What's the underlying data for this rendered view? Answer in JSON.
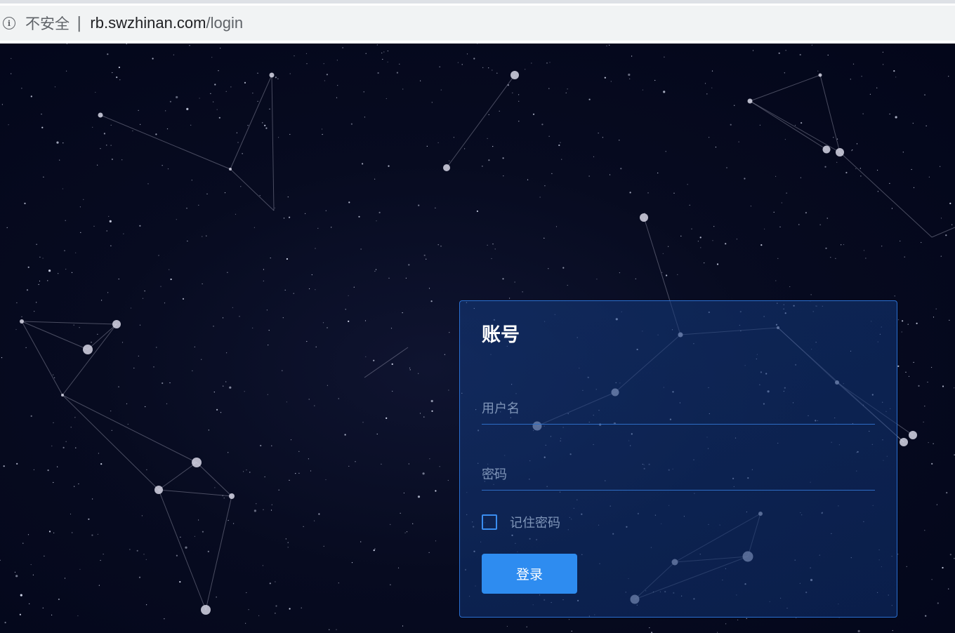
{
  "browser": {
    "security_label": "不安全",
    "separator": "|",
    "url_host": "rb.swzhinan.com",
    "url_path": "/login"
  },
  "login": {
    "title": "账号",
    "username_placeholder": "用户名",
    "password_placeholder": "密码",
    "remember_label": "记住密码",
    "remember_checked": false,
    "submit_label": "登录"
  },
  "colors": {
    "background": "#050a1c",
    "card_border": "#2a6fd0",
    "accent": "#2e8cf0"
  },
  "icons": {
    "security": "info-circle-icon"
  }
}
